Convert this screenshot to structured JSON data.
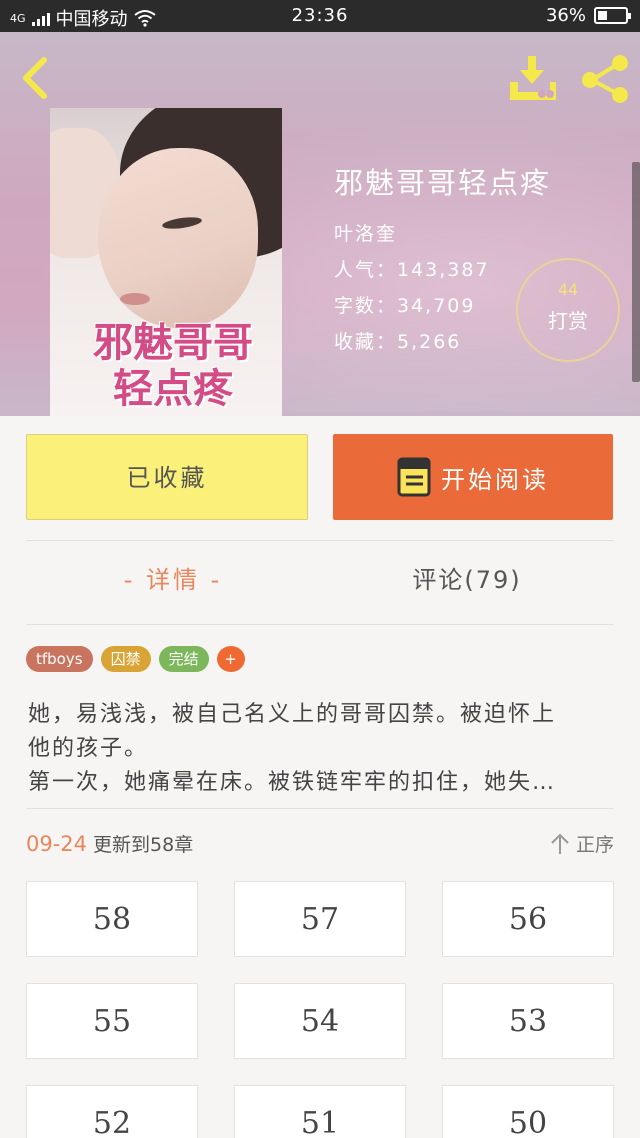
{
  "status_bar": {
    "network": "4G",
    "carrier": "中国移动",
    "time": "23:36",
    "battery": "36%",
    "battery_level": 0.36
  },
  "header": {
    "back_icon": "chevron-left-icon",
    "download_icon": "download-icon",
    "share_icon": "share-icon"
  },
  "cover": {
    "title_art": "邪魅哥哥\n轻点疼"
  },
  "book": {
    "title": "邪魅哥哥轻点疼",
    "author": "叶洛奎",
    "popularity": "人气：143,387",
    "word_count": "字数：34,709",
    "favorites": "收藏：5,266"
  },
  "reward": {
    "count": "44",
    "label": "打赏"
  },
  "actions": {
    "collected_label": "已收藏",
    "read_label": "开始阅读",
    "read_icon": "book-icon"
  },
  "tabs": {
    "detail": "- 详情 -",
    "comments": "评论(79)"
  },
  "tags": [
    {
      "label": "tfboys",
      "color": "#c9745e"
    },
    {
      "label": "囚禁",
      "color": "#d9a436"
    },
    {
      "label": "完结",
      "color": "#7cb75b"
    },
    {
      "label": "+",
      "color": "#ef6a33"
    }
  ],
  "synopsis": [
    "她，易浅浅，被自己名义上的哥哥囚禁。被迫怀上",
    "他的孩子。",
    "第一次，她痛晕在床。被铁链牢牢的扣住，她失…"
  ],
  "update": {
    "date": "09-24",
    "text": "更新到58章",
    "sort_label": "正序",
    "sort_icon": "arrow-up-icon"
  },
  "chapters": [
    "58",
    "57",
    "56",
    "55",
    "54",
    "53",
    "52",
    "51",
    "50"
  ],
  "colors": {
    "accent": "#e8875c",
    "read_button": "#ea6a3a",
    "collected_button": "#fbf07a",
    "header_icons": "#f4e84a"
  }
}
